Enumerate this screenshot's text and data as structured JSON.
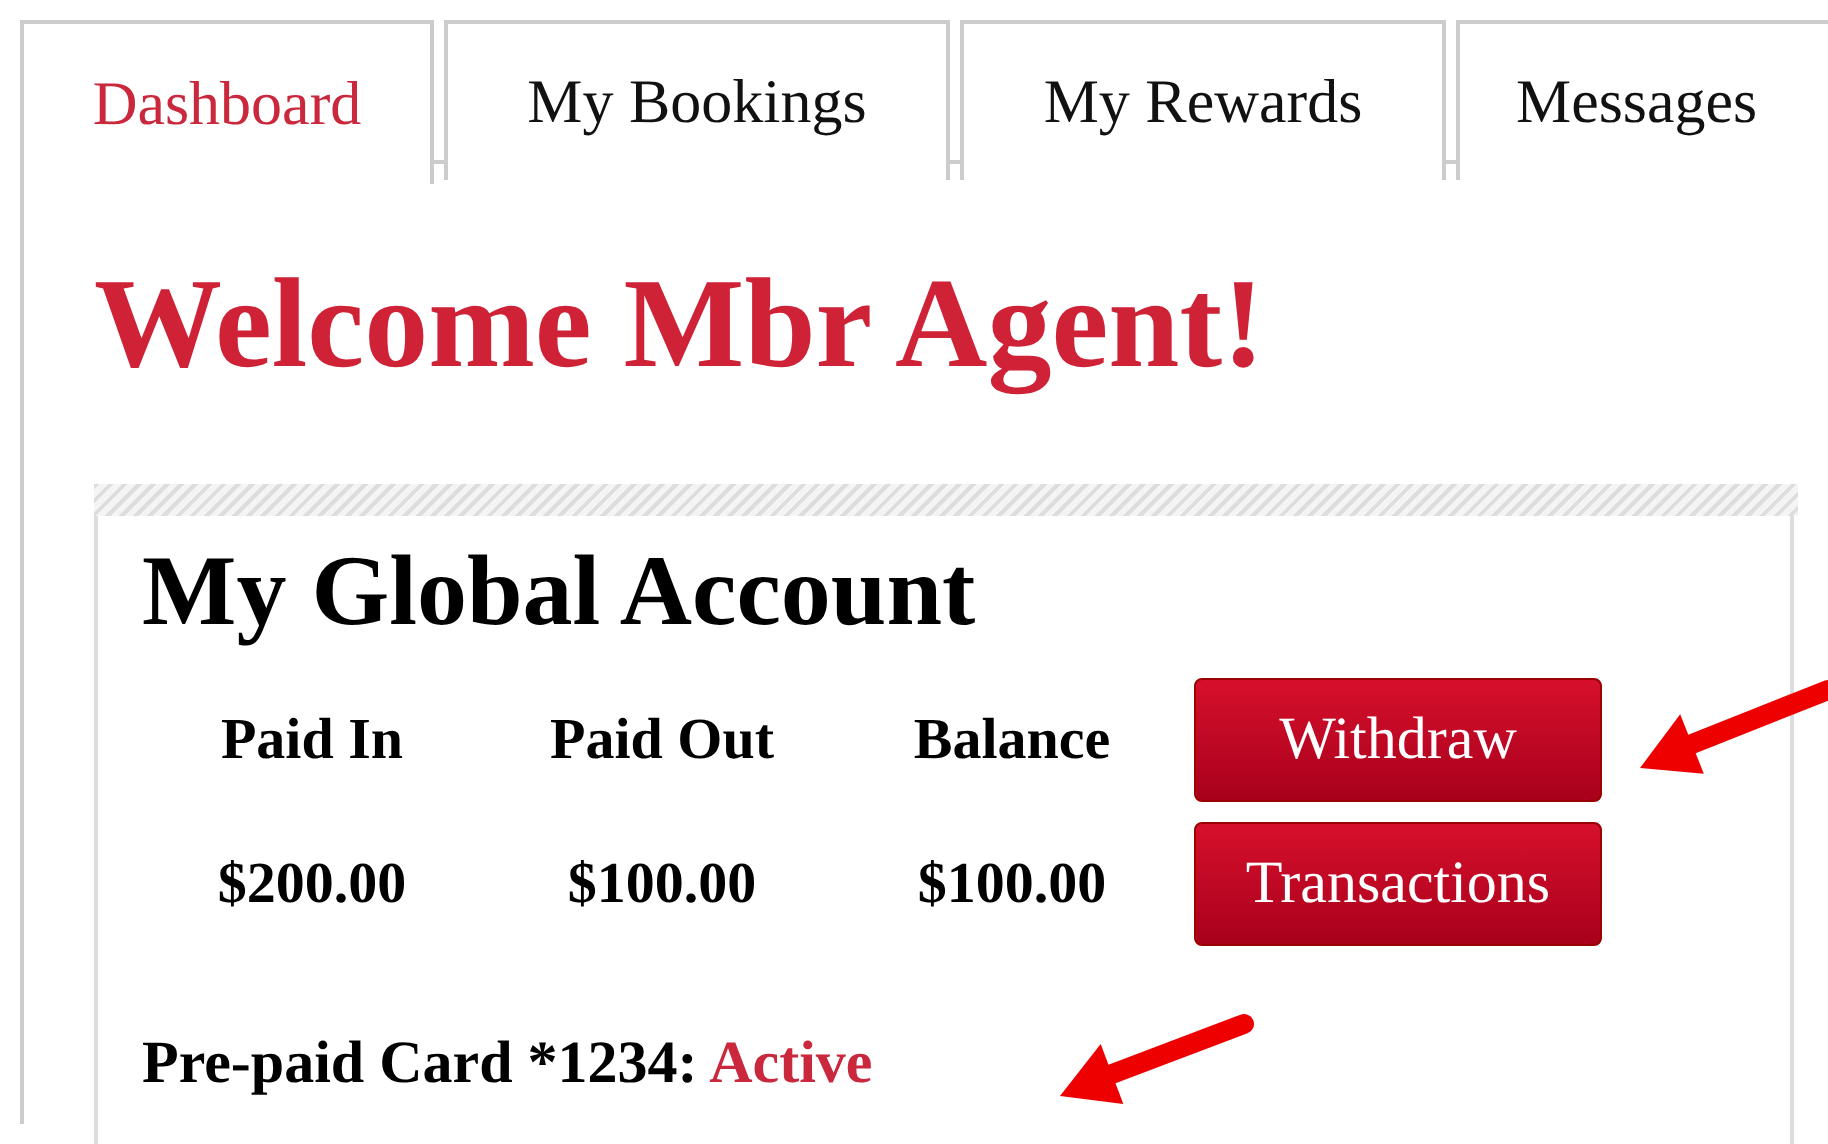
{
  "tabs": [
    {
      "label": "Dashboard",
      "selected": true
    },
    {
      "label": "My Bookings",
      "selected": false
    },
    {
      "label": "My Rewards",
      "selected": false
    },
    {
      "label": "Messages",
      "selected": false
    }
  ],
  "welcome": "Welcome Mbr Agent!",
  "account": {
    "title": "My Global Account",
    "columns": [
      "Paid In",
      "Paid Out",
      "Balance"
    ],
    "values": [
      "$200.00",
      "$100.00",
      "$100.00"
    ],
    "buttons": [
      "Withdraw",
      "Transactions"
    ],
    "card_label": "Pre-paid Card *1234:",
    "card_status": "Active"
  }
}
